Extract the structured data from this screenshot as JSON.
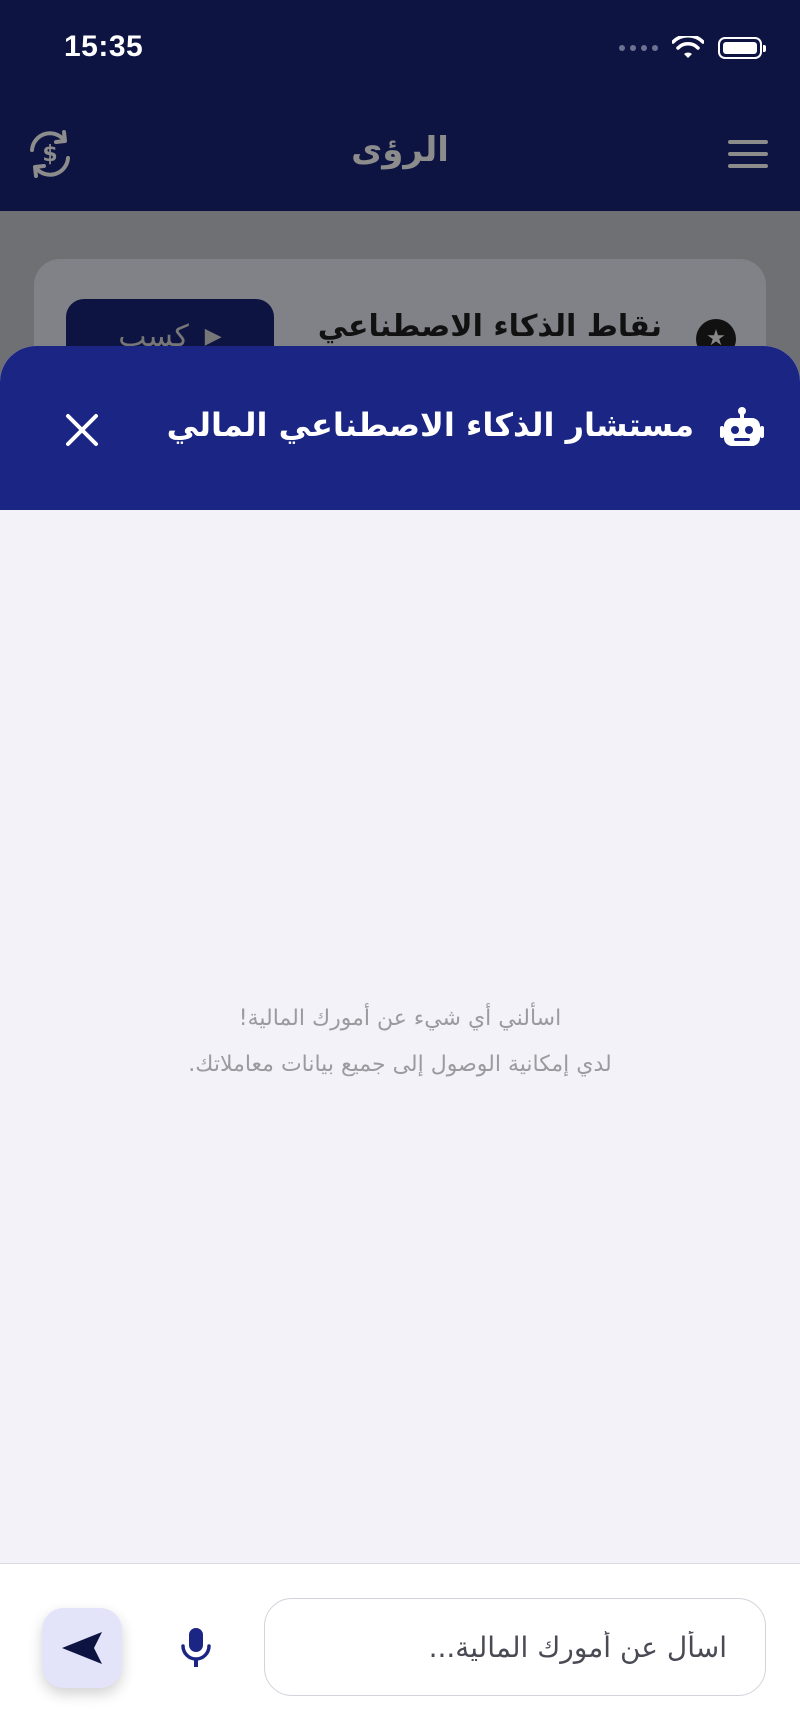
{
  "status_bar": {
    "time": "15:35"
  },
  "header": {
    "title": "الرؤى",
    "currency_icon": "currency-exchange-icon",
    "menu_icon": "hamburger-menu-icon"
  },
  "background_card": {
    "title": "نقاط الذكاء الاصطناعي",
    "earn_label": "كسب",
    "star_icon": "star-icon",
    "play_icon": "play-icon"
  },
  "sheet": {
    "title": "مستشار الذكاء الاصطناعي المالي",
    "robot_icon": "robot-icon",
    "close_icon": "close-icon",
    "empty_line1": "اسألني أي شيء عن أمورك المالية!",
    "empty_line2": "لدي إمكانية الوصول إلى جميع بيانات معاملاتك."
  },
  "composer": {
    "placeholder": "اسأل عن أمورك المالية...",
    "mic_icon": "microphone-icon",
    "send_icon": "send-icon"
  },
  "colors": {
    "navy": "#0e1442",
    "sheet_header": "#1b2583",
    "sheet_bg": "#f3f2f8",
    "send_bg": "#e3e3fa"
  }
}
